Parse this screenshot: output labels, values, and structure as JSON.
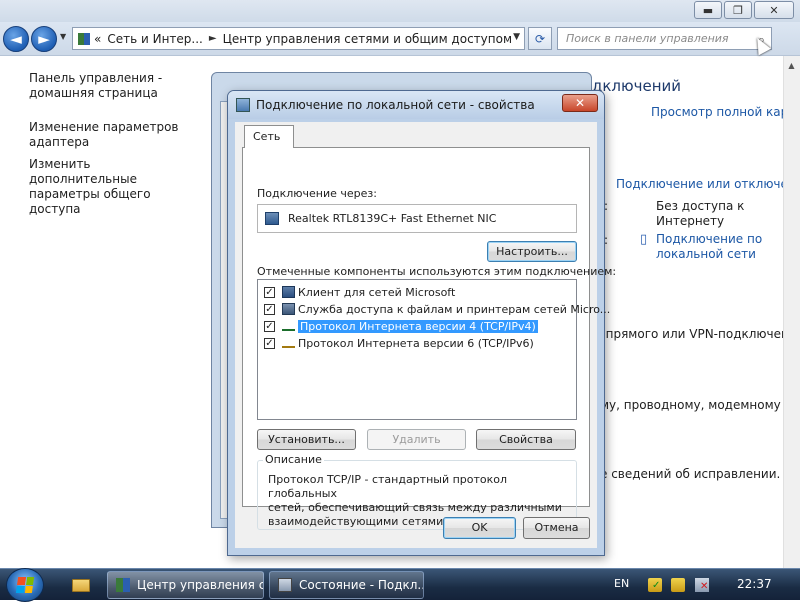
{
  "explorer": {
    "window_controls": {
      "minimize": "▬",
      "maximize": "❐",
      "close": "✕"
    },
    "nav": {
      "back": "◄",
      "forward": "►",
      "history_drop": "▼"
    },
    "address": {
      "prefix": "«",
      "crumb1": "Сеть и Интер...",
      "sep": "►",
      "crumb2": "Центр управления сетями и общим доступом",
      "drop": "▼"
    },
    "refresh": "⟳",
    "search": {
      "placeholder": "Поиск в панели управления",
      "icon": "⌕"
    },
    "sidebar": {
      "items": [
        {
          "label": "Панель управления - домашняя страница"
        },
        {
          "label": "Изменение параметров адаптера"
        },
        {
          "label": "Изменить дополнительные параметры общего доступа"
        }
      ]
    },
    "content": {
      "heading_tail": "дключений",
      "view_map": "Просмотр полной карты",
      "connect_disconnect": "Подключение или отключение",
      "colon1": ":",
      "access_status": "Без доступа к Интернету",
      "colon2": ":",
      "lan_link": "Подключение по локальной сети",
      "vpn_text": ", прямого или VPN-подключения",
      "modem_text": "му, проводному, модемному",
      "fix_text": "е сведений об исправлении."
    },
    "scroll_up": "▲"
  },
  "dialog": {
    "title": "Подключение по локальной сети - свойства",
    "close": "✕",
    "tab": "Сеть",
    "connect_via_label": "Подключение через:",
    "adapter": "Realtek RTL8139C+ Fast Ethernet NIC",
    "configure_button": "Настроить...",
    "components_label": "Отмеченные компоненты используются этим подключением:",
    "components": [
      {
        "label": "Клиент для сетей Microsoft",
        "checked": "✓",
        "selected": false
      },
      {
        "label": "Служба доступа к файлам и принтерам сетей Micro...",
        "checked": "✓",
        "selected": false
      },
      {
        "label": "Протокол Интернета версии 4 (TCP/IPv4)",
        "checked": "✓",
        "selected": true
      },
      {
        "label": "Протокол Интернета версии 6 (TCP/IPv6)",
        "checked": "✓",
        "selected": false
      }
    ],
    "install_button": "Установить...",
    "remove_button": "Удалить",
    "properties_button": "Свойства",
    "description_legend": "Описание",
    "description_text": "Протокол TCP/IP - стандартный протокол глобальных\nсетей, обеспечивающий связь между различными\nвзаимодействующими сетями.",
    "ok_button": "OK",
    "cancel_button": "Отмена"
  },
  "taskbar": {
    "tasks": [
      {
        "label": "Центр управления с..."
      },
      {
        "label": "Состояние - Подкл..."
      }
    ],
    "language": "EN",
    "clock": "22:37"
  },
  "colors": {
    "accent_link": "#1c57a5",
    "selection": "#3399ff",
    "titlebar": "#cfdbe9"
  }
}
